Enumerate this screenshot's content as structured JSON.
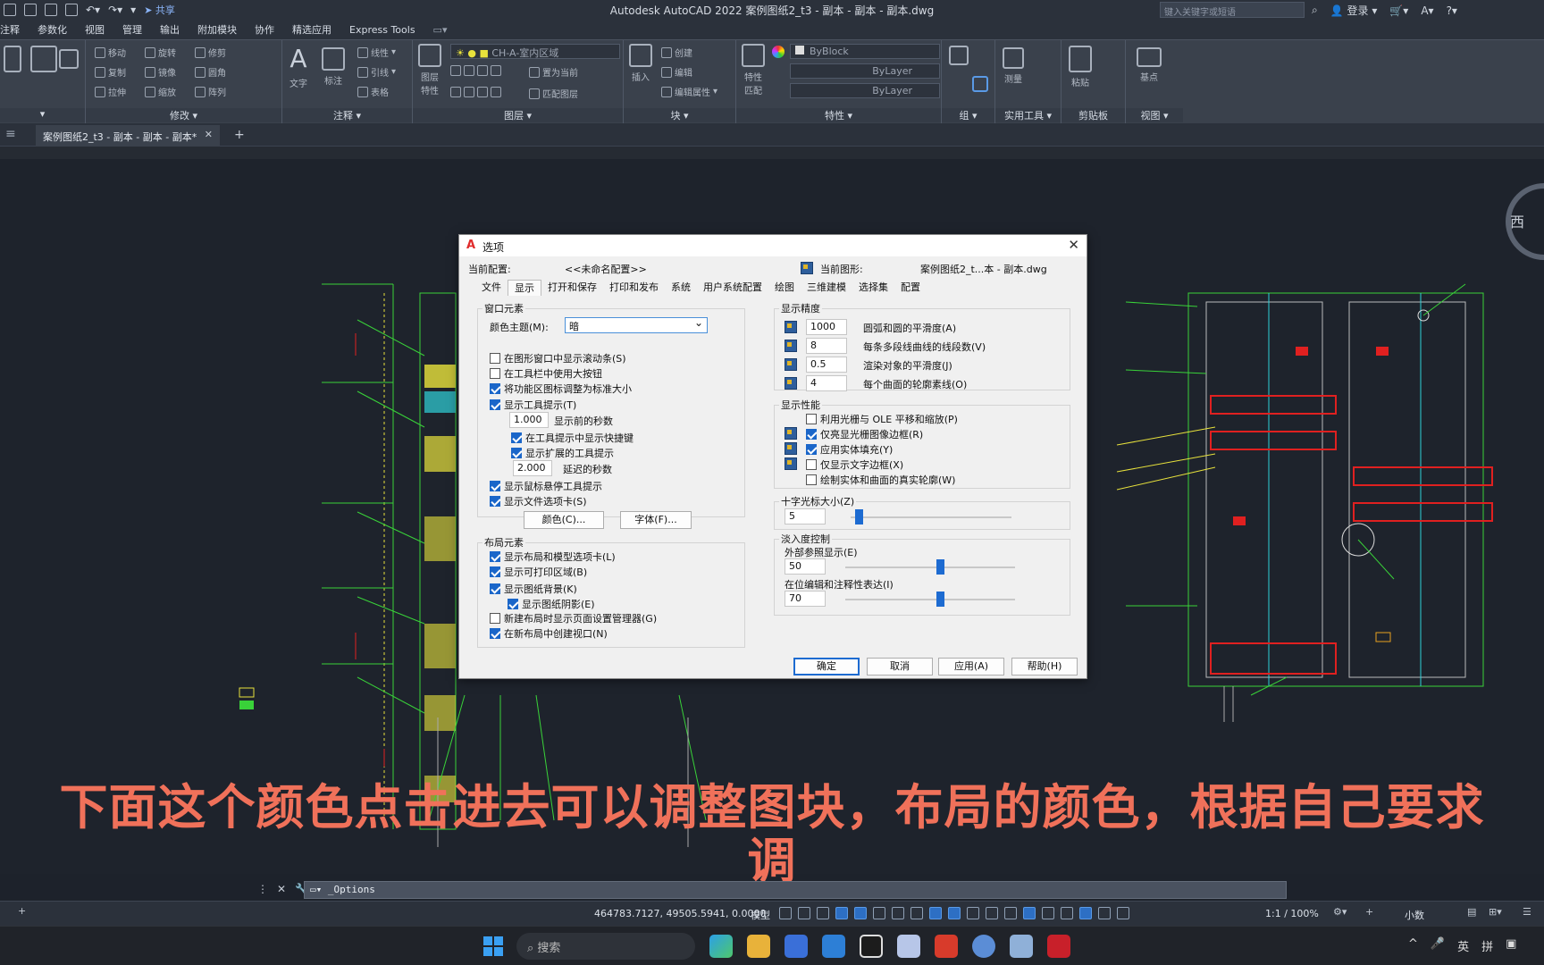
{
  "app": {
    "title": "Autodesk AutoCAD 2022    案例图纸2_t3 - 副本 - 副本 - 副本.dwg",
    "share_label": "共享",
    "search_placeholder": "键入关键字或短语",
    "login_label": "登录"
  },
  "menu": [
    "注释",
    "参数化",
    "视图",
    "管理",
    "输出",
    "附加模块",
    "协作",
    "精选应用",
    "Express Tools"
  ],
  "ribbon": {
    "panels": [
      "修改",
      "注释",
      "图层",
      "块",
      "特性",
      "组",
      "实用工具",
      "剪贴板",
      "视图"
    ],
    "modify_tools": [
      "移动",
      "旋转",
      "修剪",
      "复制",
      "镜像",
      "圆角",
      "拉伸",
      "缩放",
      "阵列"
    ],
    "annotate_tools": [
      "文字",
      "标注",
      "线性",
      "引线",
      "表格"
    ],
    "layer_tools": [
      "图层特性",
      "置为当前",
      "匹配图层"
    ],
    "layer_combo": "CH-A-室内区域",
    "block_tools": [
      "插入",
      "创建",
      "编辑",
      "编辑属性"
    ],
    "property_combos": [
      "ByBlock",
      "ByLayer",
      "ByLayer"
    ],
    "property_buttons": [
      "特性匹配"
    ],
    "utility_tools": [
      "测量"
    ],
    "clipboard_tools": [
      "粘贴"
    ],
    "view_tools": [
      "基点"
    ]
  },
  "doc_tab": "案例图纸2_t3 - 副本 - 副本 - 副本*",
  "viewcube_label": "西",
  "dialog": {
    "title": "选项",
    "current_profile_label": "当前配置:",
    "current_profile_value": "<<未命名配置>>",
    "current_drawing_label": "当前图形:",
    "current_drawing_value": "案例图纸2_t...本 - 副本.dwg",
    "tabs": [
      "文件",
      "显示",
      "打开和保存",
      "打印和发布",
      "系统",
      "用户系统配置",
      "绘图",
      "三维建模",
      "选择集",
      "配置"
    ],
    "active_tab": "显示",
    "window_elements": {
      "group_label": "窗口元素",
      "color_scheme_label": "颜色主题(M):",
      "color_scheme_value": "暗",
      "options": [
        {
          "label": "在图形窗口中显示滚动条(S)",
          "checked": false
        },
        {
          "label": "在工具栏中使用大按钮",
          "checked": false
        },
        {
          "label": "将功能区图标调整为标准大小",
          "checked": true
        },
        {
          "label": "显示工具提示(T)",
          "checked": true
        }
      ],
      "tooltip_delay_value": "1.000",
      "tooltip_delay_label": "显示前的秒数",
      "sub_options": [
        {
          "label": "在工具提示中显示快捷键",
          "checked": true
        },
        {
          "label": "显示扩展的工具提示",
          "checked": true
        }
      ],
      "extended_delay_value": "2.000",
      "extended_delay_label": "延迟的秒数",
      "more_options": [
        {
          "label": "显示鼠标悬停工具提示",
          "checked": true
        },
        {
          "label": "显示文件选项卡(S)",
          "checked": true
        }
      ],
      "colors_button": "颜色(C)...",
      "fonts_button": "字体(F)..."
    },
    "layout_elements": {
      "group_label": "布局元素",
      "options": [
        {
          "label": "显示布局和模型选项卡(L)",
          "checked": true
        },
        {
          "label": "显示可打印区域(B)",
          "checked": true
        },
        {
          "label": "显示图纸背景(K)",
          "checked": true
        },
        {
          "label": "显示图纸阴影(E)",
          "checked": true
        },
        {
          "label": "新建布局时显示页面设置管理器(G)",
          "checked": false
        },
        {
          "label": "在新布局中创建视口(N)",
          "checked": true
        }
      ]
    },
    "display_resolution": {
      "group_label": "显示精度",
      "items": [
        {
          "value": "1000",
          "label": "圆弧和圆的平滑度(A)"
        },
        {
          "value": "8",
          "label": "每条多段线曲线的线段数(V)"
        },
        {
          "value": "0.5",
          "label": "渲染对象的平滑度(J)"
        },
        {
          "value": "4",
          "label": "每个曲面的轮廓素线(O)"
        }
      ]
    },
    "display_performance": {
      "group_label": "显示性能",
      "options": [
        {
          "label": "利用光栅与 OLE 平移和缩放(P)",
          "checked": false
        },
        {
          "label": "仅亮显光栅图像边框(R)",
          "checked": true
        },
        {
          "label": "应用实体填充(Y)",
          "checked": true
        },
        {
          "label": "仅显示文字边框(X)",
          "checked": false
        },
        {
          "label": "绘制实体和曲面的真实轮廓(W)",
          "checked": false
        }
      ]
    },
    "crosshair": {
      "group_label": "十字光标大小(Z)",
      "value": "5",
      "level": 5
    },
    "fade_control": {
      "group_label": "淡入度控制",
      "xref_label": "外部参照显示(E)",
      "xref_value": "50",
      "xref_level": 50,
      "inplace_label": "在位编辑和注释性表达(I)",
      "inplace_value": "70",
      "inplace_level": 70
    },
    "buttons": {
      "ok": "确定",
      "cancel": "取消",
      "apply": "应用(A)",
      "help": "帮助(H)"
    }
  },
  "subtitle": "下面这个颜色点击进去可以调整图块，布局的颜色，根据自己要求调",
  "command_line": "_Options",
  "status": {
    "coords": "464783.7127, 49505.5941, 0.0000",
    "model": "模型",
    "scale": "1:1 / 100%",
    "units": "小数"
  },
  "taskbar": {
    "search_placeholder": "搜索",
    "tray": [
      "英",
      "拼"
    ]
  },
  "colors": {
    "accent": "#1d6bd1",
    "subtitle": "#f0715a",
    "drawing_bg": "#1e232c",
    "cad_green": "#39d239",
    "cad_yellow": "#e8e23c",
    "cad_red": "#e02020",
    "cad_cyan": "#2fd2d8"
  }
}
